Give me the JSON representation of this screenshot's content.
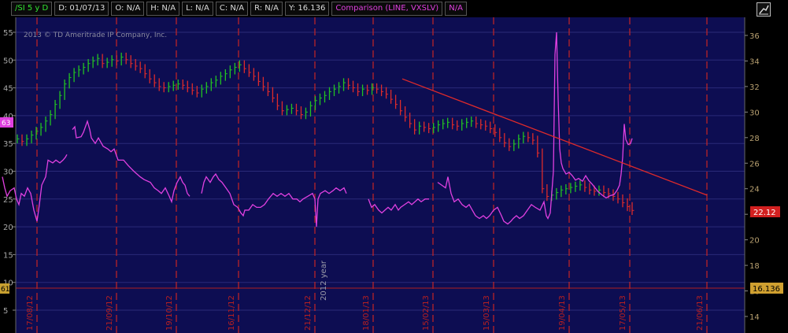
{
  "header": {
    "symbol": "/SI 5 y D",
    "date": "D: 01/07/13",
    "open": "O: N/A",
    "high": "H: N/A",
    "low": "L: N/A",
    "close": "C: N/A",
    "range": "R: N/A",
    "y_readout": "Y: 16.136",
    "comparison": "Comparison (LINE, VXSLV)",
    "comparison_value": "N/A"
  },
  "chart_data": {
    "type": "line",
    "watermark": "2013 © TD Ameritrade IP Company, Inc.",
    "year_marker": "2012 year",
    "x_dates": [
      "17/08/12",
      "21/09/12",
      "19/10/12",
      "16/11/12",
      "21/12/12",
      "18/01/13",
      "15/02/13",
      "15/03/13",
      "19/04/13",
      "17/05/13",
      "21/06/13"
    ],
    "left_axis": {
      "ylim": [
        5,
        56
      ],
      "ticks": [
        5,
        10,
        15,
        20,
        25,
        30,
        35,
        40,
        45,
        50,
        55
      ]
    },
    "right_axis": {
      "ylim": [
        13,
        36.5
      ],
      "ticks": [
        14,
        16,
        18,
        20,
        22,
        24,
        26,
        28,
        30,
        32,
        34,
        36
      ]
    },
    "badges": {
      "left_hl_value": "63",
      "left_low_value": "61",
      "right_vxslv_value": "22.12",
      "right_price_value": "16.136"
    },
    "series": [
      {
        "name": "/SI",
        "axis": "right",
        "color_up": "#22c322",
        "color_down": "#dd2b2b",
        "closes": [
          27.9,
          27.7,
          27.9,
          28.2,
          28.5,
          28.8,
          29.3,
          29.8,
          30.6,
          31.3,
          32.2,
          32.7,
          33.1,
          33.3,
          33.5,
          33.8,
          34.0,
          34.2,
          33.8,
          33.9,
          34.1,
          34.0,
          34.3,
          34.1,
          33.8,
          33.6,
          33.4,
          33.0,
          32.6,
          32.3,
          32.0,
          31.9,
          32.0,
          32.1,
          32.2,
          32.1,
          31.9,
          31.7,
          31.5,
          31.8,
          32.0,
          32.3,
          32.5,
          32.8,
          33.0,
          33.3,
          33.5,
          33.7,
          33.4,
          33.1,
          32.8,
          32.4,
          32.0,
          31.6,
          31.1,
          30.5,
          30.1,
          30.2,
          30.3,
          30.1,
          29.8,
          30.0,
          30.5,
          30.9,
          31.1,
          31.3,
          31.6,
          31.8,
          32.0,
          32.3,
          32.1,
          31.9,
          31.6,
          31.8,
          31.7,
          31.9,
          31.8,
          31.6,
          31.4,
          31.0,
          30.6,
          30.1,
          29.6,
          29.1,
          28.6,
          28.9,
          28.8,
          28.7,
          28.8,
          29.0,
          29.1,
          29.2,
          29.0,
          28.9,
          29.1,
          29.2,
          29.3,
          29.1,
          29.0,
          28.9,
          28.7,
          28.4,
          28.0,
          27.6,
          27.3,
          27.5,
          27.9,
          28.1,
          28.0,
          27.8,
          26.8,
          24.0,
          23.4,
          23.5,
          23.7,
          23.9,
          24.0,
          24.1,
          24.2,
          24.3,
          24.1,
          23.9,
          23.8,
          23.9,
          23.7,
          23.6,
          23.4,
          23.2,
          22.9,
          22.6,
          22.3
        ]
      },
      {
        "name": "VXSLV",
        "axis": "left",
        "color": "#e040e0",
        "segments": [
          [
            [
              3,
              29
            ],
            [
              6,
              27
            ],
            [
              9,
              25.5
            ],
            [
              13,
              26.5
            ],
            [
              18,
              27
            ],
            [
              21,
              25
            ],
            [
              24,
              24
            ],
            [
              27,
              26
            ],
            [
              31,
              25.5
            ],
            [
              35,
              27
            ],
            [
              39,
              26
            ],
            [
              43,
              23
            ],
            [
              47,
              21
            ],
            [
              50,
              24
            ],
            [
              53,
              27.5
            ],
            [
              58,
              29
            ],
            [
              61,
              32
            ],
            [
              67,
              31.5
            ],
            [
              71,
              32
            ],
            [
              76,
              31.5
            ],
            [
              80,
              32
            ],
            [
              83,
              32.5
            ],
            [
              85,
              33
            ]
          ],
          [
            [
              92,
              37.5
            ],
            [
              95,
              38
            ],
            [
              97,
              36
            ],
            [
              103,
              36.2
            ],
            [
              106,
              37
            ],
            [
              111,
              39
            ],
            [
              114,
              37.5
            ],
            [
              116,
              36
            ],
            [
              121,
              35
            ],
            [
              125,
              36
            ],
            [
              131,
              34.5
            ],
            [
              137,
              34
            ],
            [
              141,
              33.5
            ],
            [
              145,
              34
            ],
            [
              150,
              32
            ],
            [
              153,
              32
            ],
            [
              157,
              32
            ],
            [
              163,
              31
            ],
            [
              170,
              30
            ],
            [
              178,
              29
            ],
            [
              183,
              28.5
            ],
            [
              191,
              28
            ],
            [
              196,
              27
            ],
            [
              201,
              26.5
            ],
            [
              205,
              26
            ],
            [
              210,
              27
            ],
            [
              215,
              25.5
            ],
            [
              218,
              24.5
            ],
            [
              221,
              26.5
            ],
            [
              225,
              28
            ],
            [
              229,
              29
            ],
            [
              232,
              28
            ],
            [
              235,
              27.5
            ],
            [
              238,
              26
            ],
            [
              241,
              25.5
            ]
          ],
          [
            [
              256,
              26
            ],
            [
              259,
              28
            ],
            [
              262,
              29
            ],
            [
              267,
              28
            ],
            [
              271,
              29
            ],
            [
              274,
              29.5
            ],
            [
              278,
              28.5
            ],
            [
              282,
              28
            ],
            [
              287,
              27
            ],
            [
              292,
              26
            ],
            [
              297,
              24
            ],
            [
              302,
              23.5
            ],
            [
              306,
              22.5
            ],
            [
              309,
              22
            ],
            [
              311,
              23
            ],
            [
              316,
              23
            ],
            [
              321,
              24
            ],
            [
              326,
              23.5
            ],
            [
              331,
              23.5
            ],
            [
              336,
              24
            ],
            [
              341,
              25
            ],
            [
              347,
              26
            ],
            [
              352,
              25.5
            ],
            [
              357,
              26
            ],
            [
              362,
              25.5
            ],
            [
              367,
              26
            ],
            [
              372,
              25
            ],
            [
              377,
              25
            ],
            [
              381,
              24.5
            ],
            [
              385,
              25
            ],
            [
              391,
              25.5
            ],
            [
              397,
              26
            ],
            [
              400,
              25
            ],
            [
              402,
              20
            ],
            [
              404,
              25
            ],
            [
              407,
              26
            ],
            [
              413,
              26.5
            ],
            [
              418,
              26
            ],
            [
              423,
              26.5
            ],
            [
              427,
              27
            ],
            [
              432,
              26.5
            ],
            [
              437,
              27
            ],
            [
              440,
              26
            ]
          ],
          [
            [
              468,
              25
            ],
            [
              472,
              23.5
            ],
            [
              476,
              24
            ],
            [
              481,
              23
            ],
            [
              485,
              22.5
            ],
            [
              489,
              23
            ],
            [
              493,
              23.5
            ],
            [
              497,
              23
            ],
            [
              502,
              24
            ],
            [
              506,
              23
            ],
            [
              509,
              23.5
            ],
            [
              514,
              24
            ],
            [
              519,
              24.5
            ],
            [
              523,
              24
            ],
            [
              527,
              24.5
            ],
            [
              531,
              25
            ],
            [
              535,
              24.5
            ],
            [
              540,
              25
            ],
            [
              545,
              25
            ]
          ],
          [
            [
              556,
              28
            ],
            [
              561,
              27.5
            ],
            [
              566,
              27
            ],
            [
              569,
              29
            ],
            [
              573,
              26
            ],
            [
              577,
              24.5
            ],
            [
              582,
              25
            ],
            [
              587,
              24
            ],
            [
              592,
              23.5
            ],
            [
              596,
              24
            ],
            [
              600,
              23
            ],
            [
              604,
              22
            ],
            [
              609,
              21.5
            ],
            [
              614,
              22
            ],
            [
              618,
              21.5
            ],
            [
              622,
              22
            ],
            [
              627,
              23
            ],
            [
              632,
              23.5
            ],
            [
              637,
              22
            ],
            [
              640,
              21
            ],
            [
              645,
              20.5
            ],
            [
              649,
              21
            ],
            [
              652,
              21.5
            ],
            [
              656,
              22
            ],
            [
              660,
              21.5
            ],
            [
              665,
              22
            ],
            [
              670,
              23
            ],
            [
              675,
              24
            ],
            [
              680,
              23.5
            ],
            [
              686,
              23
            ],
            [
              691,
              24.5
            ],
            [
              694,
              22
            ],
            [
              696,
              21.5
            ],
            [
              699,
              22.5
            ],
            [
              703,
              30
            ],
            [
              705,
              51
            ],
            [
              707,
              55
            ],
            [
              709,
              43
            ],
            [
              711,
              34
            ],
            [
              713,
              31.5
            ],
            [
              715,
              30.5
            ],
            [
              719,
              29.5
            ],
            [
              723,
              29.8
            ],
            [
              727,
              29.2
            ],
            [
              731,
              28.4
            ],
            [
              735,
              28.7
            ],
            [
              740,
              28.2
            ],
            [
              744,
              29.2
            ],
            [
              748,
              28.3
            ],
            [
              752,
              27.7
            ],
            [
              756,
              27
            ],
            [
              760,
              26.3
            ],
            [
              765,
              25.7
            ],
            [
              770,
              25.2
            ],
            [
              775,
              25.6
            ],
            [
              780,
              25.8
            ],
            [
              784,
              26.6
            ],
            [
              787,
              27.5
            ],
            [
              789,
              29.5
            ],
            [
              791,
              32.5
            ],
            [
              793,
              38.5
            ],
            [
              795,
              35.7
            ],
            [
              798,
              34.8
            ],
            [
              801,
              35
            ],
            [
              803,
              35.9
            ]
          ]
        ]
      }
    ],
    "trendline": {
      "from": [
        511,
        32.6
      ],
      "to": [
        898,
        23.5
      ],
      "color": "#e02a2a"
    }
  }
}
